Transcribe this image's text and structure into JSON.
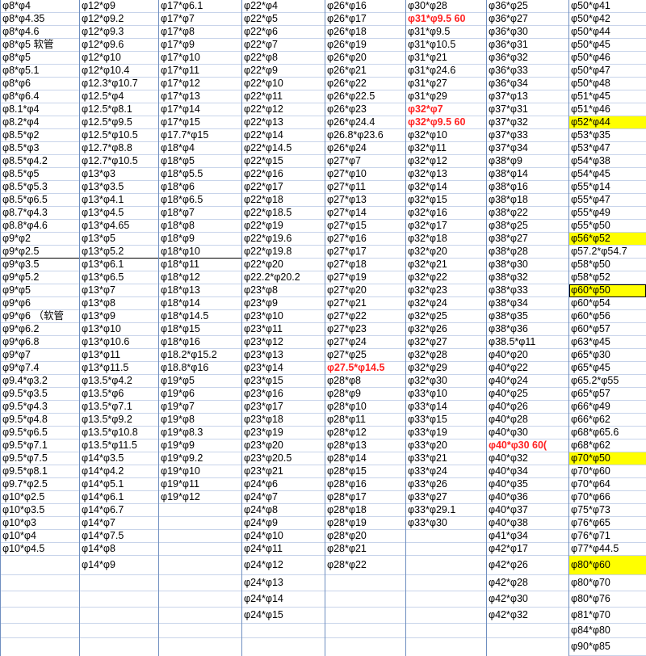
{
  "highlight_color": "#ffff00",
  "red_color": "#ff2222",
  "columns": [
    {
      "cells": [
        {
          "t": "φ8*φ4"
        },
        {
          "t": "φ8*φ4.35"
        },
        {
          "t": "φ8*φ4.6"
        },
        {
          "t": "φ8*φ5 软管"
        },
        {
          "t": "φ8*φ5"
        },
        {
          "t": "φ8*φ5.1"
        },
        {
          "t": "φ8*φ6"
        },
        {
          "t": "φ8*φ6.4"
        },
        {
          "t": "φ8.1*φ4"
        },
        {
          "t": "φ8.2*φ4"
        },
        {
          "t": "φ8.5*φ2"
        },
        {
          "t": "φ8.5*φ3"
        },
        {
          "t": "φ8.5*φ4.2"
        },
        {
          "t": "φ8.5*φ5"
        },
        {
          "t": "φ8.5*φ5.3"
        },
        {
          "t": "φ8.5*φ6.5"
        },
        {
          "t": "φ8.7*φ4.3"
        },
        {
          "t": "φ8.8*φ4.6"
        },
        {
          "t": "φ9*φ2"
        },
        {
          "t": "φ9*φ2.5"
        },
        {
          "t": "φ9*φ3.5"
        },
        {
          "t": "φ9*φ5.2"
        },
        {
          "t": "φ9*φ5"
        },
        {
          "t": "φ9*φ6"
        },
        {
          "t": "φ9*φ6 （软管"
        },
        {
          "t": "φ9*φ6.2"
        },
        {
          "t": "φ9*φ6.8"
        },
        {
          "t": "φ9*φ7"
        },
        {
          "t": "φ9*φ7.4"
        },
        {
          "t": "φ9.4*φ3.2"
        },
        {
          "t": "φ9.5*φ3.5"
        },
        {
          "t": "φ9.5*φ4.3"
        },
        {
          "t": "φ9.5*φ4.8"
        },
        {
          "t": "φ9.5*φ6.5"
        },
        {
          "t": "φ9.5*φ7.1"
        },
        {
          "t": "φ9.5*φ7.5"
        },
        {
          "t": "φ9.5*φ8.1"
        },
        {
          "t": "φ9.7*φ2.5"
        },
        {
          "t": "φ10*φ2.5"
        },
        {
          "t": "φ10*φ3.5"
        },
        {
          "t": "φ10*φ3"
        },
        {
          "t": "φ10*φ4"
        },
        {
          "t": "φ10*φ4.5"
        },
        {
          "t": "",
          "h": 24
        },
        {
          "t": "",
          "h": 20
        },
        {
          "t": "",
          "h": 20
        },
        {
          "t": "",
          "h": 20
        },
        {
          "t": "",
          "h": 18
        }
      ]
    },
    {
      "cells": [
        {
          "t": "φ12*φ9"
        },
        {
          "t": "φ12*φ9.2"
        },
        {
          "t": "φ12*φ9.3"
        },
        {
          "t": "φ12*φ9.6"
        },
        {
          "t": "φ12*φ10"
        },
        {
          "t": "φ12*φ10.4"
        },
        {
          "t": "φ12.3*φ10.7"
        },
        {
          "t": "φ12.5*φ4"
        },
        {
          "t": "φ12.5*φ8.1"
        },
        {
          "t": "φ12.5*φ9.5"
        },
        {
          "t": "φ12.5*φ10.5"
        },
        {
          "t": "φ12.7*φ8.8"
        },
        {
          "t": "φ12.7*φ10.5"
        },
        {
          "t": "φ13*φ3"
        },
        {
          "t": "φ13*φ3.5"
        },
        {
          "t": "φ13*φ4.1"
        },
        {
          "t": "φ13*φ4.5"
        },
        {
          "t": "φ13*φ4.65"
        },
        {
          "t": "φ13*φ5"
        },
        {
          "t": "φ13*φ5.2"
        },
        {
          "t": "φ13*φ6.1"
        },
        {
          "t": "φ13*φ6.5"
        },
        {
          "t": "φ13*φ7"
        },
        {
          "t": "φ13*φ8"
        },
        {
          "t": "φ13*φ9"
        },
        {
          "t": "φ13*φ10"
        },
        {
          "t": "φ13*φ10.6"
        },
        {
          "t": "φ13*φ11"
        },
        {
          "t": "φ13*φ11.5"
        },
        {
          "t": "φ13.5*φ4.2"
        },
        {
          "t": "φ13.5*φ6"
        },
        {
          "t": "φ13.5*φ7.1"
        },
        {
          "t": "φ13.5*φ9.2"
        },
        {
          "t": "φ13.5*φ10.8"
        },
        {
          "t": "φ13.5*φ11.5"
        },
        {
          "t": "φ14*φ3.5"
        },
        {
          "t": "φ14*φ4.2"
        },
        {
          "t": "φ14*φ5.1"
        },
        {
          "t": "φ14*φ6.1"
        },
        {
          "t": "φ14*φ6.7"
        },
        {
          "t": "φ14*φ7"
        },
        {
          "t": "φ14*φ7.5"
        },
        {
          "t": "φ14*φ8"
        },
        {
          "t": "φ14*φ9",
          "h": 24
        },
        {
          "t": "",
          "h": 20
        },
        {
          "t": "",
          "h": 20
        },
        {
          "t": "",
          "h": 20
        },
        {
          "t": "",
          "h": 18
        }
      ]
    },
    {
      "cells": [
        {
          "t": "φ17*φ6.1"
        },
        {
          "t": "φ17*φ7"
        },
        {
          "t": "φ17*φ8"
        },
        {
          "t": "φ17*φ9"
        },
        {
          "t": "φ17*φ10"
        },
        {
          "t": "φ17*φ11"
        },
        {
          "t": "φ17*φ12"
        },
        {
          "t": "φ17*φ13"
        },
        {
          "t": "φ17*φ14"
        },
        {
          "t": "φ17*φ15"
        },
        {
          "t": "φ17.7*φ15"
        },
        {
          "t": "φ18*φ4"
        },
        {
          "t": "φ18*φ5"
        },
        {
          "t": "φ18*φ5.5"
        },
        {
          "t": "φ18*φ6"
        },
        {
          "t": "φ18*φ6.5"
        },
        {
          "t": "φ18*φ7"
        },
        {
          "t": "φ18*φ8"
        },
        {
          "t": "φ18*φ9"
        },
        {
          "t": "φ18*φ10"
        },
        {
          "t": "φ18*φ11"
        },
        {
          "t": "φ18*φ12"
        },
        {
          "t": "φ18*φ13"
        },
        {
          "t": "φ18*φ14"
        },
        {
          "t": "φ18*φ14.5"
        },
        {
          "t": "φ18*φ15"
        },
        {
          "t": "φ18*φ16"
        },
        {
          "t": "φ18.2*φ15.2"
        },
        {
          "t": "φ18.8*φ16"
        },
        {
          "t": "φ19*φ5"
        },
        {
          "t": "φ19*φ6"
        },
        {
          "t": "φ19*φ7"
        },
        {
          "t": "φ19*φ8"
        },
        {
          "t": "φ19*φ8.3"
        },
        {
          "t": "φ19*φ9"
        },
        {
          "t": "φ19*φ9.2"
        },
        {
          "t": "φ19*φ10"
        },
        {
          "t": "φ19*φ11"
        },
        {
          "t": "φ19*φ12"
        },
        {
          "t": ""
        },
        {
          "t": ""
        },
        {
          "t": ""
        },
        {
          "t": ""
        },
        {
          "t": "",
          "h": 24
        },
        {
          "t": "",
          "h": 20
        },
        {
          "t": "",
          "h": 20
        },
        {
          "t": "",
          "h": 20
        },
        {
          "t": "",
          "h": 18
        }
      ]
    },
    {
      "cells": [
        {
          "t": "φ22*φ4"
        },
        {
          "t": "φ22*φ5"
        },
        {
          "t": "φ22*φ6"
        },
        {
          "t": "φ22*φ7"
        },
        {
          "t": "φ22*φ8"
        },
        {
          "t": "φ22*φ9"
        },
        {
          "t": "φ22*φ10"
        },
        {
          "t": "φ22*φ11"
        },
        {
          "t": "φ22*φ12"
        },
        {
          "t": "φ22*φ13"
        },
        {
          "t": "φ22*φ14"
        },
        {
          "t": "φ22*φ14.5"
        },
        {
          "t": "φ22*φ15"
        },
        {
          "t": "φ22*φ16"
        },
        {
          "t": "φ22*φ17"
        },
        {
          "t": "φ22*φ18"
        },
        {
          "t": "φ22*φ18.5"
        },
        {
          "t": "φ22*φ19"
        },
        {
          "t": "φ22*φ19.6"
        },
        {
          "t": "φ22*φ19.8"
        },
        {
          "t": "φ22*φ20"
        },
        {
          "t": "φ22.2*φ20.2"
        },
        {
          "t": "φ23*φ8"
        },
        {
          "t": "φ23*φ9"
        },
        {
          "t": "φ23*φ10"
        },
        {
          "t": "φ23*φ11"
        },
        {
          "t": "φ23*φ12"
        },
        {
          "t": "φ23*φ13"
        },
        {
          "t": "φ23*φ14"
        },
        {
          "t": "φ23*φ15"
        },
        {
          "t": "φ23*φ16"
        },
        {
          "t": "φ23*φ17"
        },
        {
          "t": "φ23*φ18"
        },
        {
          "t": "φ23*φ19"
        },
        {
          "t": "φ23*φ20"
        },
        {
          "t": "φ23*φ20.5"
        },
        {
          "t": "φ23*φ21"
        },
        {
          "t": "φ24*φ6"
        },
        {
          "t": "φ24*φ7"
        },
        {
          "t": "φ24*φ8"
        },
        {
          "t": "φ24*φ9"
        },
        {
          "t": "φ24*φ10"
        },
        {
          "t": "φ24*φ11"
        },
        {
          "t": "φ24*φ12",
          "h": 24
        },
        {
          "t": "φ24*φ13",
          "h": 20
        },
        {
          "t": "φ24*φ14",
          "h": 20
        },
        {
          "t": "φ24*φ15",
          "h": 20
        },
        {
          "t": "",
          "h": 18
        }
      ]
    },
    {
      "cells": [
        {
          "t": "φ26*φ16"
        },
        {
          "t": "φ26*φ17"
        },
        {
          "t": "φ26*φ18"
        },
        {
          "t": "φ26*φ19"
        },
        {
          "t": "φ26*φ20"
        },
        {
          "t": "φ26*φ21"
        },
        {
          "t": "φ26*φ22"
        },
        {
          "t": "φ26*φ22.5"
        },
        {
          "t": "φ26*φ23"
        },
        {
          "t": "φ26*φ24.4"
        },
        {
          "t": "φ26.8*φ23.6"
        },
        {
          "t": "φ26*φ24"
        },
        {
          "t": "φ27*φ7"
        },
        {
          "t": "φ27*φ10"
        },
        {
          "t": "φ27*φ11"
        },
        {
          "t": "φ27*φ13"
        },
        {
          "t": "φ27*φ14"
        },
        {
          "t": "φ27*φ15"
        },
        {
          "t": "φ27*φ16"
        },
        {
          "t": "φ27*φ17"
        },
        {
          "t": "φ27*φ18"
        },
        {
          "t": "φ27*φ19"
        },
        {
          "t": "φ27*φ20"
        },
        {
          "t": "φ27*φ21"
        },
        {
          "t": "φ27*φ22"
        },
        {
          "t": "φ27*φ23"
        },
        {
          "t": "φ27*φ24"
        },
        {
          "t": "φ27*φ25"
        },
        {
          "t": "φ27.5*φ14.5",
          "s": "r"
        },
        {
          "t": "φ28*φ8"
        },
        {
          "t": "φ28*φ9"
        },
        {
          "t": "φ28*φ10"
        },
        {
          "t": "φ28*φ11"
        },
        {
          "t": "φ28*φ12"
        },
        {
          "t": "φ28*φ13"
        },
        {
          "t": "φ28*φ14"
        },
        {
          "t": "φ28*φ15"
        },
        {
          "t": "φ28*φ16"
        },
        {
          "t": "φ28*φ17"
        },
        {
          "t": "φ28*φ18"
        },
        {
          "t": "φ28*φ19"
        },
        {
          "t": "φ28*φ20"
        },
        {
          "t": "φ28*φ21"
        },
        {
          "t": "φ28*φ22",
          "h": 24
        },
        {
          "t": "",
          "h": 20
        },
        {
          "t": "",
          "h": 20
        },
        {
          "t": "",
          "h": 20
        },
        {
          "t": "",
          "h": 18
        }
      ]
    },
    {
      "cells": [
        {
          "t": "φ30*φ28"
        },
        {
          "t": "φ31*φ9.5 60",
          "s": "r"
        },
        {
          "t": "φ31*φ9.5"
        },
        {
          "t": "φ31*φ10.5"
        },
        {
          "t": "φ31*φ21"
        },
        {
          "t": "φ31*φ24.6"
        },
        {
          "t": "φ31*φ27"
        },
        {
          "t": "φ31*φ29"
        },
        {
          "t": "φ32*φ7",
          "s": "r"
        },
        {
          "t": "φ32*φ9.5 60",
          "s": "r"
        },
        {
          "t": "φ32*φ10"
        },
        {
          "t": "φ32*φ11"
        },
        {
          "t": "φ32*φ12"
        },
        {
          "t": "φ32*φ13"
        },
        {
          "t": "φ32*φ14"
        },
        {
          "t": "φ32*φ15"
        },
        {
          "t": "φ32*φ16"
        },
        {
          "t": "φ32*φ17"
        },
        {
          "t": "φ32*φ18"
        },
        {
          "t": "φ32*φ20"
        },
        {
          "t": "φ32*φ21"
        },
        {
          "t": "φ32*φ22"
        },
        {
          "t": "φ32*φ23"
        },
        {
          "t": "φ32*φ24"
        },
        {
          "t": "φ32*φ25"
        },
        {
          "t": "φ32*φ26"
        },
        {
          "t": "φ32*φ27"
        },
        {
          "t": "φ32*φ28"
        },
        {
          "t": "φ32*φ29"
        },
        {
          "t": "φ32*φ30"
        },
        {
          "t": "φ33*φ10"
        },
        {
          "t": "φ33*φ14"
        },
        {
          "t": "φ33*φ15"
        },
        {
          "t": "φ33*φ19"
        },
        {
          "t": "φ33*φ20"
        },
        {
          "t": "φ33*φ21"
        },
        {
          "t": "φ33*φ24"
        },
        {
          "t": "φ33*φ26"
        },
        {
          "t": "φ33*φ27"
        },
        {
          "t": "φ33*φ29.1"
        },
        {
          "t": "φ33*φ30"
        },
        {
          "t": ""
        },
        {
          "t": ""
        },
        {
          "t": "",
          "h": 24
        },
        {
          "t": "",
          "h": 20
        },
        {
          "t": "",
          "h": 20
        },
        {
          "t": "",
          "h": 20
        },
        {
          "t": "",
          "h": 18
        }
      ]
    },
    {
      "cells": [
        {
          "t": "φ36*φ25"
        },
        {
          "t": "φ36*φ27"
        },
        {
          "t": "φ36*φ30"
        },
        {
          "t": "φ36*φ31"
        },
        {
          "t": "φ36*φ32"
        },
        {
          "t": "φ36*φ33"
        },
        {
          "t": "φ36*φ34"
        },
        {
          "t": "φ37*φ13"
        },
        {
          "t": "φ37*φ31"
        },
        {
          "t": "φ37*φ32"
        },
        {
          "t": "φ37*φ33"
        },
        {
          "t": "φ37*φ34"
        },
        {
          "t": "φ38*φ9"
        },
        {
          "t": "φ38*φ14"
        },
        {
          "t": "φ38*φ16"
        },
        {
          "t": "φ38*φ18"
        },
        {
          "t": "φ38*φ22"
        },
        {
          "t": "φ38*φ25"
        },
        {
          "t": "φ38*φ27"
        },
        {
          "t": "φ38*φ28"
        },
        {
          "t": "φ38*φ30"
        },
        {
          "t": "φ38*φ32"
        },
        {
          "t": "φ38*φ33"
        },
        {
          "t": "φ38*φ34"
        },
        {
          "t": "φ38*φ35"
        },
        {
          "t": "φ38*φ36"
        },
        {
          "t": "φ38.5*φ11"
        },
        {
          "t": "φ40*φ20"
        },
        {
          "t": "φ40*φ22"
        },
        {
          "t": "φ40*φ24"
        },
        {
          "t": "φ40*φ25"
        },
        {
          "t": "φ40*φ26"
        },
        {
          "t": "φ40*φ28"
        },
        {
          "t": "φ40*φ30"
        },
        {
          "t": "φ40*φ30 60(",
          "s": "r"
        },
        {
          "t": "φ40*φ32"
        },
        {
          "t": "φ40*φ34"
        },
        {
          "t": "φ40*φ35"
        },
        {
          "t": "φ40*φ36"
        },
        {
          "t": "φ40*φ37"
        },
        {
          "t": "φ40*φ38"
        },
        {
          "t": "φ41*φ34"
        },
        {
          "t": "φ42*φ17"
        },
        {
          "t": "φ42*φ26",
          "h": 24
        },
        {
          "t": "φ42*φ28",
          "h": 20
        },
        {
          "t": "φ42*φ30",
          "h": 20
        },
        {
          "t": "φ42*φ32",
          "h": 20
        },
        {
          "t": "",
          "h": 18
        }
      ]
    },
    {
      "cells": [
        {
          "t": "φ50*φ41"
        },
        {
          "t": "φ50*φ42"
        },
        {
          "t": "φ50*φ44"
        },
        {
          "t": "φ50*φ45"
        },
        {
          "t": "φ50*φ46"
        },
        {
          "t": "φ50*φ47"
        },
        {
          "t": "φ50*φ48"
        },
        {
          "t": "φ51*φ45"
        },
        {
          "t": "φ51*φ46"
        },
        {
          "t": "φ52*φ44",
          "s": "y"
        },
        {
          "t": "φ53*φ35"
        },
        {
          "t": "φ53*φ47"
        },
        {
          "t": "φ54*φ38"
        },
        {
          "t": "φ54*φ45"
        },
        {
          "t": "φ55*φ14"
        },
        {
          "t": "φ55*φ47"
        },
        {
          "t": "φ55*φ49"
        },
        {
          "t": "φ55*φ50"
        },
        {
          "t": "φ56*φ52",
          "s": "y"
        },
        {
          "t": "φ57.2*φ54.7"
        },
        {
          "t": "φ58*φ50"
        },
        {
          "t": "φ58*φ52"
        },
        {
          "t": "φ60*φ50",
          "s": "y box"
        },
        {
          "t": "φ60*φ54"
        },
        {
          "t": "φ60*φ56"
        },
        {
          "t": "φ60*φ57"
        },
        {
          "t": "φ63*φ45"
        },
        {
          "t": "φ65*φ30"
        },
        {
          "t": "φ65*φ45"
        },
        {
          "t": "φ65.2*φ55"
        },
        {
          "t": "φ65*φ57"
        },
        {
          "t": "φ66*φ49"
        },
        {
          "t": "φ66*φ62"
        },
        {
          "t": "φ68*φ65.6"
        },
        {
          "t": "φ68*φ62"
        },
        {
          "t": "φ70*φ50",
          "s": "y"
        },
        {
          "t": "φ70*φ60"
        },
        {
          "t": "φ70*φ64"
        },
        {
          "t": "φ70*φ66"
        },
        {
          "t": "φ75*φ73"
        },
        {
          "t": "φ76*φ65"
        },
        {
          "t": "φ76*φ71"
        },
        {
          "t": "φ77*φ44.5"
        },
        {
          "t": "φ80*φ60",
          "s": "y",
          "h": 24
        },
        {
          "t": "φ80*φ70",
          "h": 20
        },
        {
          "t": "φ80*φ76",
          "h": 20
        },
        {
          "t": "φ81*φ70",
          "h": 20
        },
        {
          "t": "φ84*φ80",
          "h": 18
        },
        {
          "t": "φ90*φ85",
          "h": 22
        }
      ]
    }
  ]
}
